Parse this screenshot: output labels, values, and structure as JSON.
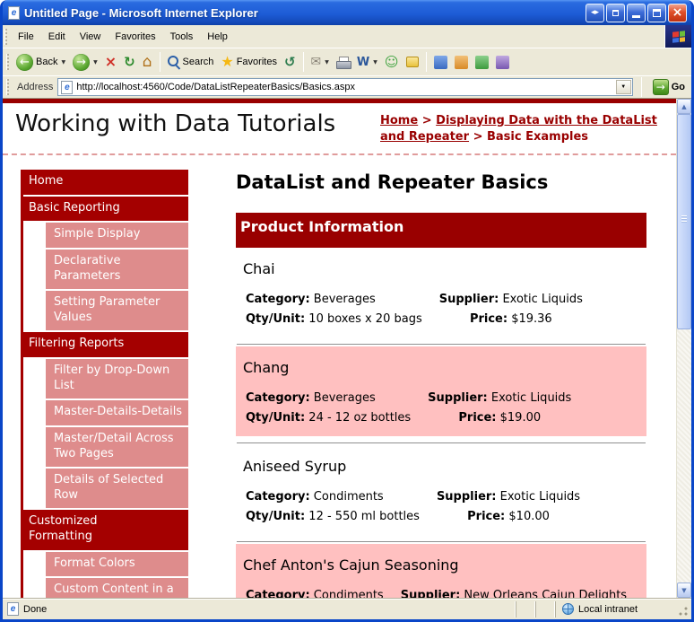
{
  "window": {
    "title": "Untitled Page - Microsoft Internet Explorer"
  },
  "menu_bar": {
    "items": [
      "File",
      "Edit",
      "View",
      "Favorites",
      "Tools",
      "Help"
    ]
  },
  "toolbar": {
    "back_label": "Back",
    "search_label": "Search",
    "favorites_label": "Favorites"
  },
  "address_bar": {
    "label": "Address",
    "url": "http://localhost:4560/Code/DataListRepeaterBasics/Basics.aspx",
    "go_label": "Go"
  },
  "status_bar": {
    "status": "Done",
    "zone": "Local intranet"
  },
  "icons": {
    "back": "←",
    "forward": "→",
    "stop": "×",
    "refresh": "↻",
    "home": "⌂",
    "star": "★",
    "history": "↺",
    "mail": "✉",
    "edit": "W",
    "messenger": "☺",
    "chevron_down": "▼",
    "go": "→",
    "close": "×",
    "window_arrows": "◂▸",
    "scroll_up": "▲",
    "scroll_down": "▼"
  },
  "colors": {
    "maroon": "#990000",
    "sidebar_red": "#A40000",
    "salmon": "#DE8C8C",
    "row_pink": "#FFC0C0",
    "chrome_tan": "#ECE9D8",
    "title_blue": "#1D5CD6",
    "close_red": "#E0502A"
  },
  "page": {
    "site_title": "Working with Data Tutorials",
    "breadcrumb": {
      "home": "Home",
      "separator": ">",
      "section": "Displaying Data with the DataList and Repeater",
      "current": "Basic Examples"
    },
    "sidebar": {
      "items": [
        {
          "label": "Home",
          "level": 0
        },
        {
          "label": "Basic Reporting",
          "level": 0
        },
        {
          "label": "Simple Display",
          "level": 1
        },
        {
          "label": "Declarative Parameters",
          "level": 1
        },
        {
          "label": "Setting Parameter Values",
          "level": 1
        },
        {
          "label": "Filtering Reports",
          "level": 0
        },
        {
          "label": "Filter by Drop-Down List",
          "level": 1
        },
        {
          "label": "Master-Details-Details",
          "level": 1
        },
        {
          "label": "Master/Detail Across Two Pages",
          "level": 1
        },
        {
          "label": "Details of Selected Row",
          "level": 1
        },
        {
          "label": "Customized Formatting",
          "level": 0
        },
        {
          "label": "Format Colors",
          "level": 1
        },
        {
          "label": "Custom Content in a",
          "level": 1
        }
      ]
    },
    "main": {
      "heading": "DataList and Repeater Basics",
      "banner": "Product Information",
      "labels": {
        "category": "Category:",
        "supplier": "Supplier:",
        "qty": "Qty/Unit:",
        "price": "Price:"
      },
      "products": [
        {
          "name": "Chai",
          "category": "Beverages",
          "supplier": "Exotic Liquids",
          "qty": "10 boxes x 20 bags",
          "price": "$19.36",
          "alt": false
        },
        {
          "name": "Chang",
          "category": "Beverages",
          "supplier": "Exotic Liquids",
          "qty": "24 - 12 oz bottles",
          "price": "$19.00",
          "alt": true
        },
        {
          "name": "Aniseed Syrup",
          "category": "Condiments",
          "supplier": "Exotic Liquids",
          "qty": "12 - 550 ml bottles",
          "price": "$10.00",
          "alt": false
        },
        {
          "name": "Chef Anton's Cajun Seasoning",
          "category": "Condiments",
          "supplier": "New Orleans Cajun Delights",
          "qty": "",
          "price": "",
          "alt": true,
          "truncated": true
        }
      ]
    }
  }
}
